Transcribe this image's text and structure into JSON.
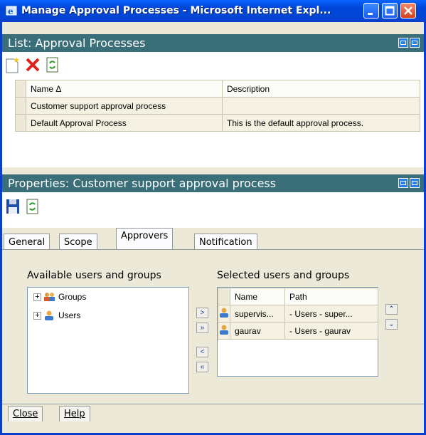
{
  "window": {
    "title": "Manage Approval Processes - Microsoft Internet Expl..."
  },
  "list_section": {
    "title": "List: Approval Processes",
    "toolbar": [
      "new-icon",
      "delete-icon",
      "refresh-icon"
    ],
    "columns": [
      "Name Δ",
      "Description"
    ],
    "rows": [
      {
        "name": "Customer support approval process",
        "description": ""
      },
      {
        "name": "Default Approval Process",
        "description": "This is the default approval process."
      }
    ]
  },
  "properties_section": {
    "title": "Properties: Customer support approval process",
    "toolbar": [
      "save-icon",
      "refresh-icon"
    ],
    "tabs": [
      "General",
      "Scope",
      "Approvers",
      "Notification"
    ],
    "active_tab": "Approvers",
    "available_label": "Available users and groups",
    "available_items": [
      {
        "label": "Groups",
        "icon": "groups-icon"
      },
      {
        "label": "Users",
        "icon": "user-icon"
      }
    ],
    "selected_label": "Selected users and groups",
    "selected_columns": [
      "Name",
      "Path"
    ],
    "selected_rows": [
      {
        "name": "supervis...",
        "path": "- Users - super..."
      },
      {
        "name": "gaurav",
        "path": "- Users - gaurav"
      }
    ]
  },
  "footer": {
    "close_label": "Close",
    "help_label": "Help"
  }
}
